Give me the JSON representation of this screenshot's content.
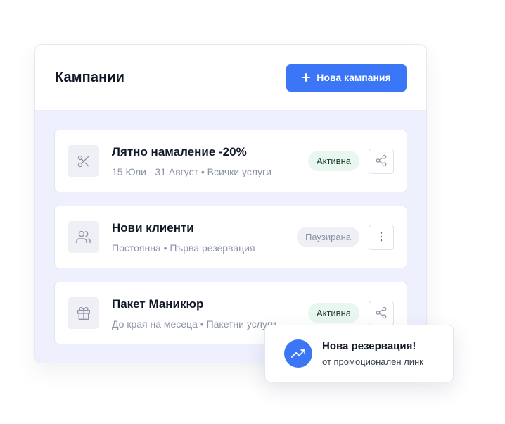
{
  "header": {
    "title": "Кампании",
    "new_button_label": "Нова кампания"
  },
  "campaigns": [
    {
      "icon": "scissors-icon",
      "title": "Лятно намаление -20%",
      "subtitle": "15 Юли - 31 Август • Всички услуги",
      "status": "Активна",
      "action_icon": "share-icon"
    },
    {
      "icon": "users-icon",
      "title": "Нови клиенти",
      "subtitle": "Постоянна • Първа резервация",
      "status": "Паузирана",
      "action_icon": "more-vertical-icon"
    },
    {
      "icon": "gift-icon",
      "title": "Пакет Маникюр",
      "subtitle": "До края на месеца • Пакетни услуги",
      "status": "Активна",
      "action_icon": "share-icon"
    }
  ],
  "toast": {
    "icon": "trending-up-icon",
    "title": "Нова резервация!",
    "subtitle": "от промоционален линк"
  },
  "colors": {
    "accent": "#3b76f6",
    "active_badge_bg": "#e8f7ef",
    "paused_badge_bg": "#eef0f5",
    "list_bg": "#eef0fd"
  }
}
